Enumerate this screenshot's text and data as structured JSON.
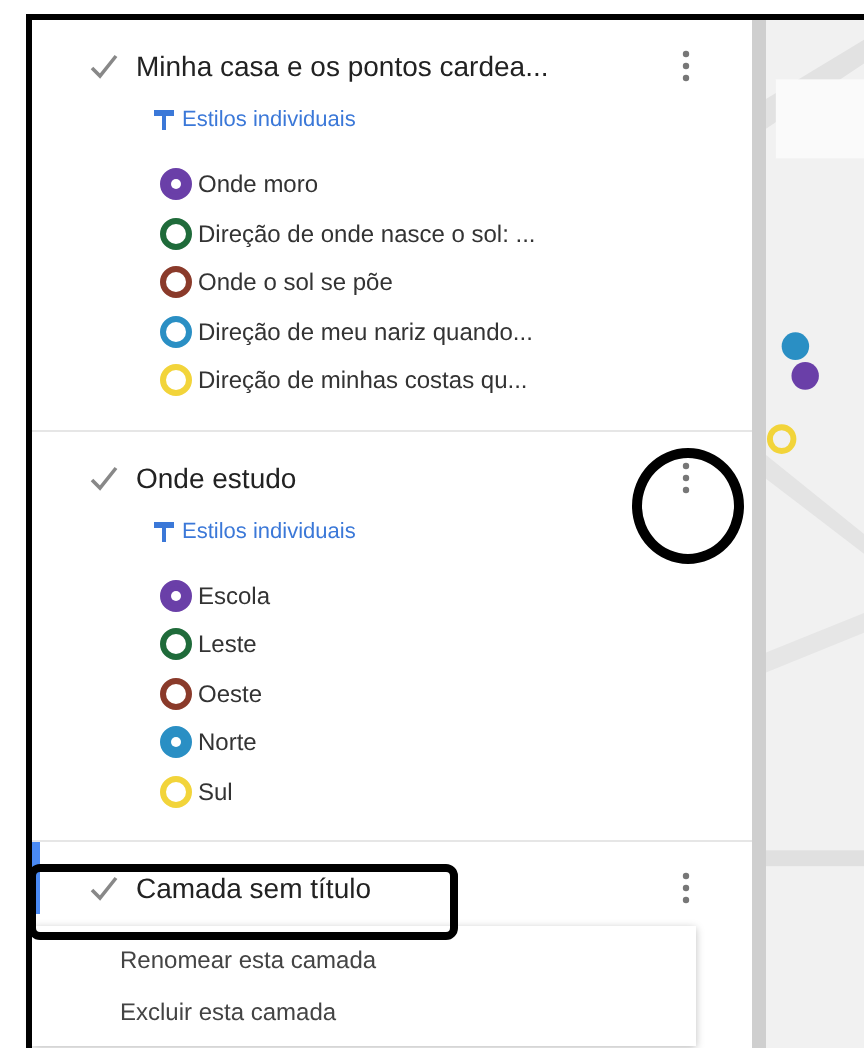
{
  "layers": [
    {
      "title": "Minha casa e os pontos cardea...",
      "checked": true,
      "selected": false,
      "style_link": "Estilos individuais",
      "items": [
        {
          "label": "Onde moro",
          "kind": "filled",
          "color": "#6a3fa8"
        },
        {
          "label": "Direção de onde nasce o sol: ...",
          "kind": "ring",
          "color": "#1f6b3a"
        },
        {
          "label": "Onde o sol se põe",
          "kind": "ring",
          "color": "#8a3a2a"
        },
        {
          "label": "Direção de meu nariz quando...",
          "kind": "ring",
          "color": "#2a8fc4"
        },
        {
          "label": "Direção de minhas costas qu...",
          "kind": "ring",
          "color": "#f2d43a"
        }
      ]
    },
    {
      "title": "Onde estudo",
      "checked": true,
      "selected": false,
      "annotation": {
        "kind": "circle"
      },
      "style_link": "Estilos individuais",
      "items": [
        {
          "label": "Escola",
          "kind": "filled",
          "color": "#6a3fa8"
        },
        {
          "label": "Leste",
          "kind": "ring",
          "color": "#1f6b3a"
        },
        {
          "label": "Oeste",
          "kind": "ring",
          "color": "#8a3a2a"
        },
        {
          "label": "Norte",
          "kind": "filled",
          "color": "#2a8fc4"
        },
        {
          "label": "Sul",
          "kind": "ring",
          "color": "#f2d43a"
        }
      ]
    },
    {
      "title": "Camada sem título",
      "checked": true,
      "selected": true,
      "annotation": {
        "kind": "rect"
      },
      "menu": [
        "Renomear esta camada",
        "Excluir esta camada"
      ]
    }
  ]
}
